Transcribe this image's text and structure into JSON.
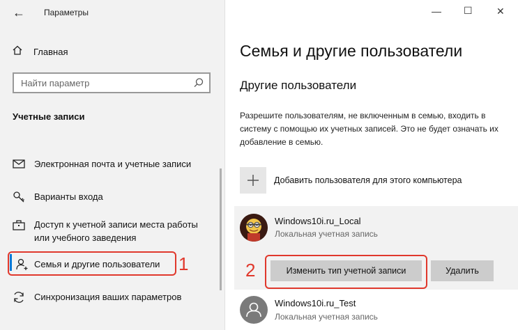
{
  "window": {
    "app_title": "Параметры",
    "controls": {
      "minimize": "—",
      "maximize": "☐",
      "close": "✕"
    }
  },
  "sidebar": {
    "back_glyph": "←",
    "home_label": "Главная",
    "search": {
      "placeholder": "Найти параметр"
    },
    "section_title": "Учетные записи",
    "items": [
      {
        "label": "Электронная почта и учетные записи",
        "icon": "mail-icon"
      },
      {
        "label": "Варианты входа",
        "icon": "key-icon"
      },
      {
        "label": "Доступ к учетной записи места работы или учебного заведения",
        "icon": "briefcase-icon"
      },
      {
        "label": "Семья и другие пользователи",
        "icon": "person-add-icon",
        "active": true
      },
      {
        "label": "Синхронизация ваших параметров",
        "icon": "sync-icon"
      }
    ]
  },
  "annotations": {
    "one": "1",
    "two": "2"
  },
  "main": {
    "title": "Семья и другие пользователи",
    "subtitle": "Другие пользователи",
    "description": "Разрешите пользователям, не включенным в семью, входить в систему с помощью их учетных записей. Это не будет означать их добавление в семью.",
    "add_user_label": "Добавить пользователя для этого компьютера",
    "users": [
      {
        "name": "Windows10i.ru_Local",
        "type": "Локальная учетная запись"
      },
      {
        "name": "Windows10i.ru_Test",
        "type": "Локальная учетная запись"
      }
    ],
    "change_type_button": "Изменить тип учетной записи",
    "delete_button": "Удалить"
  },
  "colors": {
    "accent": "#0078d7",
    "callout": "#e0382c",
    "sidebar_bg": "#f2f2f2",
    "button_bg": "#cccccc"
  }
}
